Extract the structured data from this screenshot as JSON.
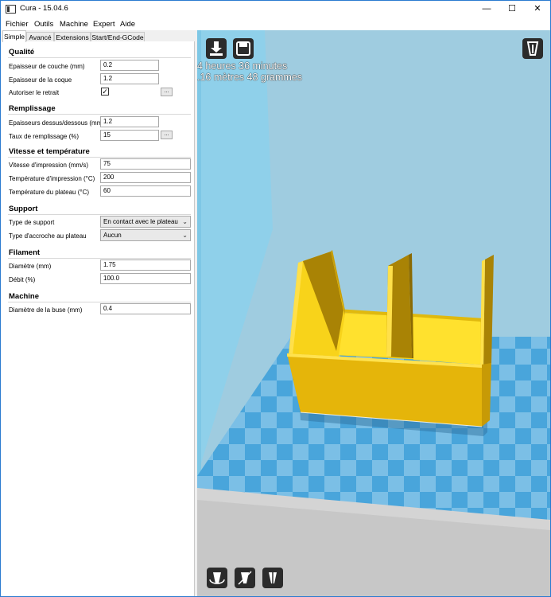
{
  "window": {
    "title": "Cura - 15.04.6",
    "minimize": "—",
    "maximize": "☐",
    "close": "✕"
  },
  "menu": [
    "Fichier",
    "Outils",
    "Machine",
    "Expert",
    "Aide"
  ],
  "tabs": [
    "Simple",
    "Avancé",
    "Extensions",
    "Start/End-GCode"
  ],
  "sections": {
    "qualite": {
      "title": "Qualité",
      "layer_height_label": "Epaisseur de couche (mm)",
      "layer_height": "0.2",
      "shell_label": "Epaisseur de la coque",
      "shell": "1.2",
      "retraction_label": "Autoriser le retrait",
      "retraction_checked": "✓"
    },
    "remplissage": {
      "title": "Remplissage",
      "topbottom_label": "Epaisseurs dessus/dessous (mm)",
      "topbottom": "1.2",
      "density_label": "Taux de remplissage (%)",
      "density": "15"
    },
    "vitesse": {
      "title": "Vitesse et température",
      "speed_label": "Vitesse d'impression (mm/s)",
      "speed": "75",
      "temp_label": "Température d'impression (°C)",
      "temp": "200",
      "bed_label": "Température du plateau (°C)",
      "bed": "60"
    },
    "support": {
      "title": "Support",
      "type_label": "Type de support",
      "type": "En contact avec le plateau",
      "adhesion_label": "Type d'accroche au plateau",
      "adhesion": "Aucun"
    },
    "filament": {
      "title": "Filament",
      "diameter_label": "Diamètre (mm)",
      "diameter": "1.75",
      "flow_label": "Débit (%)",
      "flow": "100.0"
    },
    "machine": {
      "title": "Machine",
      "nozzle_label": "Diamètre de la buse (mm)",
      "nozzle": "0.4"
    }
  },
  "dots_label": "...",
  "viewport": {
    "print_time": "4 heures 36 minutes",
    "print_material": ".16 mètres 48 grammes"
  },
  "icons": [
    "load-icon",
    "save-icon",
    "view-mode-icon",
    "rotate-icon",
    "scale-icon",
    "mirror-icon"
  ],
  "colors": {
    "model": "#f5d21a",
    "bed": "#4aa3d8",
    "accent": "#2b7bd0"
  }
}
